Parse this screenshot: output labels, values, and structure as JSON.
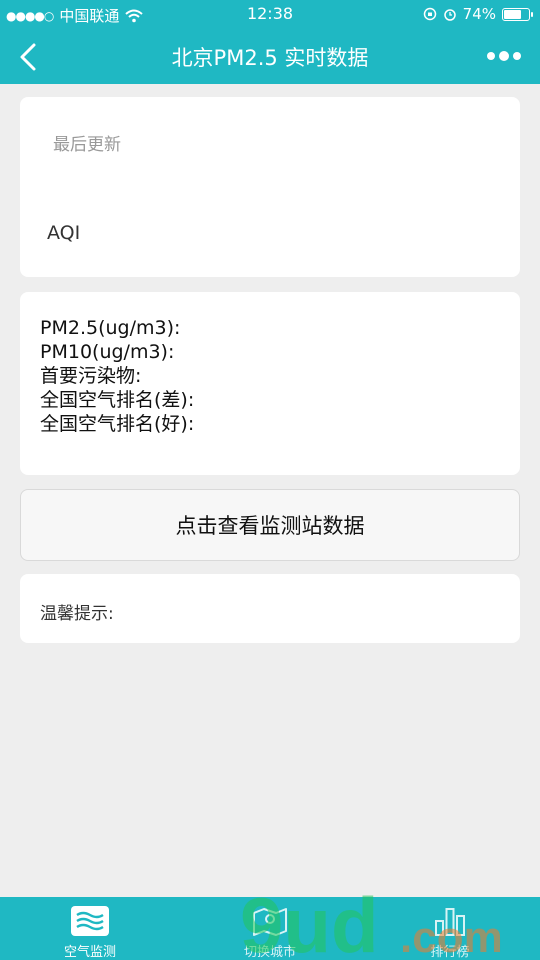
{
  "status_bar": {
    "carrier": "中国联通",
    "time": "12:38",
    "battery_percent": "74%",
    "battery_level": 0.74
  },
  "nav": {
    "title": "北京PM2.5 实时数据"
  },
  "summary_card": {
    "last_update_label": "最后更新",
    "aqi_label": "AQI"
  },
  "details_card": {
    "rows": [
      "PM2.5(ug/m3):",
      "PM10(ug/m3):",
      "首要污染物:",
      "全国空气排名(差):",
      "全国空气排名(好):"
    ]
  },
  "stations_button": {
    "label": "点击查看监测站数据"
  },
  "tips_card": {
    "label": "温馨提示:"
  },
  "tabbar": {
    "tabs": [
      {
        "label": "空气监测",
        "icon": "air-waves-icon",
        "active": true
      },
      {
        "label": "切换城市",
        "icon": "map-icon",
        "active": false
      },
      {
        "label": "排行榜",
        "icon": "ranking-bars-icon",
        "active": false
      }
    ]
  },
  "watermark": {
    "text": "9ud.com"
  },
  "colors": {
    "primary": "#1fb8c3",
    "background": "#eeeeee",
    "card": "#ffffff"
  }
}
